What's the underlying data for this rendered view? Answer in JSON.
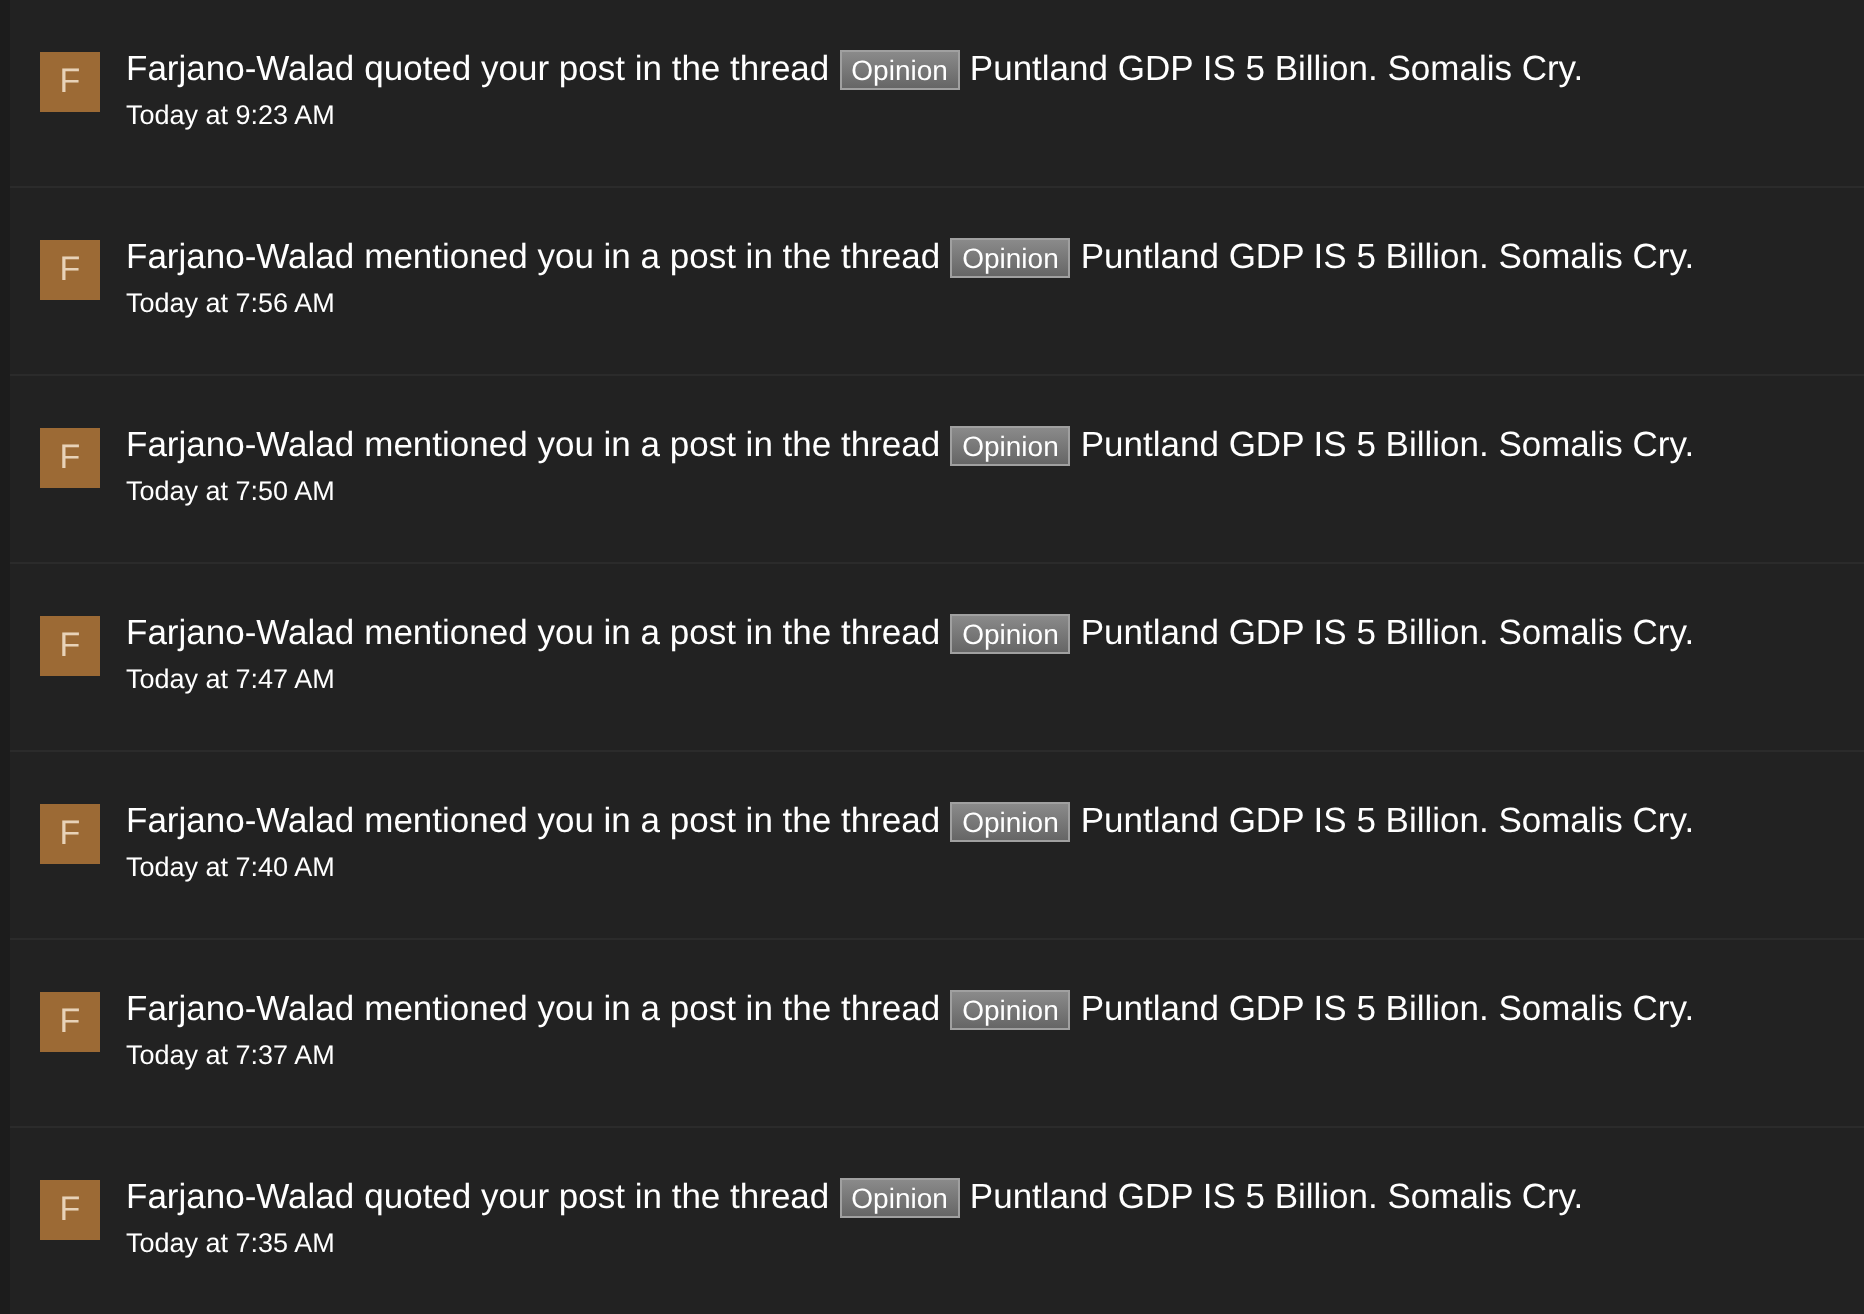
{
  "notifications": [
    {
      "avatar": "F",
      "user": "Farjano-Walad",
      "action": "quoted your post in the thread",
      "prefix": "Opinion",
      "thread": "Puntland GDP IS 5 Billion. Somalis Cry.",
      "time": "Today at 9:23 AM"
    },
    {
      "avatar": "F",
      "user": "Farjano-Walad",
      "action": "mentioned you in a post in the thread",
      "prefix": "Opinion",
      "thread": "Puntland GDP IS 5 Billion. Somalis Cry.",
      "time": "Today at 7:56 AM"
    },
    {
      "avatar": "F",
      "user": "Farjano-Walad",
      "action": "mentioned you in a post in the thread",
      "prefix": "Opinion",
      "thread": "Puntland GDP IS 5 Billion. Somalis Cry.",
      "time": "Today at 7:50 AM"
    },
    {
      "avatar": "F",
      "user": "Farjano-Walad",
      "action": "mentioned you in a post in the thread",
      "prefix": "Opinion",
      "thread": "Puntland GDP IS 5 Billion. Somalis Cry.",
      "time": "Today at 7:47 AM"
    },
    {
      "avatar": "F",
      "user": "Farjano-Walad",
      "action": "mentioned you in a post in the thread",
      "prefix": "Opinion",
      "thread": "Puntland GDP IS 5 Billion. Somalis Cry.",
      "time": "Today at 7:40 AM"
    },
    {
      "avatar": "F",
      "user": "Farjano-Walad",
      "action": "mentioned you in a post in the thread",
      "prefix": "Opinion",
      "thread": "Puntland GDP IS 5 Billion. Somalis Cry.",
      "time": "Today at 7:37 AM"
    },
    {
      "avatar": "F",
      "user": "Farjano-Walad",
      "action": "quoted your post in the thread",
      "prefix": "Opinion",
      "thread": "Puntland GDP IS 5 Billion. Somalis Cry.",
      "time": "Today at 7:35 AM"
    }
  ]
}
